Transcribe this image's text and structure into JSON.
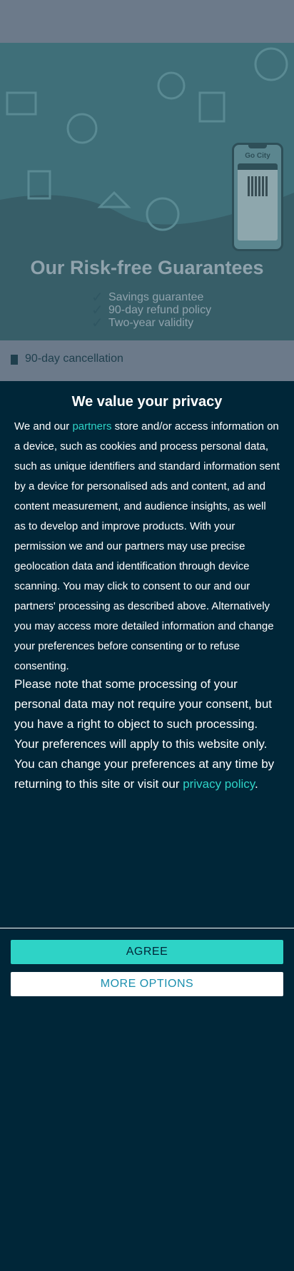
{
  "hero": {
    "title": "Our Risk-free Guarantees",
    "guarantees": [
      "Savings guarantee",
      "90-day refund policy",
      "Two-year validity"
    ],
    "phone_brand": "Go City"
  },
  "strip": {
    "label": "90-day cancellation"
  },
  "privacy": {
    "title": "We value your privacy",
    "p1_before_link": "We and our ",
    "p1_link": "partners",
    "p1_after_link": " store and/or access information on a device, such as cookies and process personal data, such as unique identifiers and standard information sent by a device for personalised ads and content, ad and content measurement, and audience insights, as well as to develop and improve products. With your permission we and our partners may use precise geolocation data and identification through device scanning. You may click to consent to our and our partners' processing as described above. Alternatively you may access more detailed information and change your preferences before consenting or to refuse consenting.",
    "p2_before_link": "Please note that some processing of your personal data may not require your consent, but you have a right to object to such processing. Your preferences will apply to this website only. You can change your preferences at any time by returning to this site or visit our ",
    "p2_link": "privacy policy",
    "p2_after_link": "."
  },
  "buttons": {
    "agree": "AGREE",
    "more_options": "MORE OPTIONS"
  },
  "colors": {
    "accent": "#2ed3c6",
    "background": "#002638",
    "link": "#2ed3c6"
  }
}
